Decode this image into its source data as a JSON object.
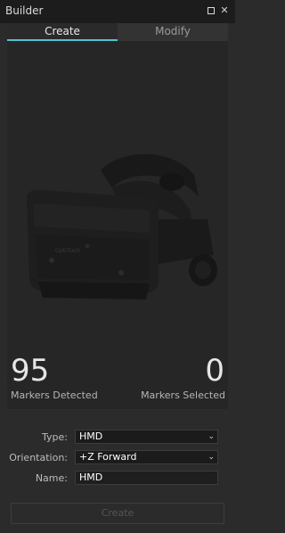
{
  "window": {
    "title": "Builder"
  },
  "tabs": [
    {
      "label": "Create",
      "active": true
    },
    {
      "label": "Modify",
      "active": false
    }
  ],
  "viewport": {
    "image": "hmd-headset",
    "brand_text": "OptiTrack"
  },
  "stats": {
    "detected": {
      "count": "95",
      "label": "Markers Detected"
    },
    "selected": {
      "count": "0",
      "label": "Markers Selected"
    }
  },
  "form": {
    "type": {
      "label": "Type:",
      "value": "HMD"
    },
    "orientation": {
      "label": "Orientation:",
      "value": "+Z Forward"
    },
    "name": {
      "label": "Name:",
      "value": "HMD"
    }
  },
  "actions": {
    "create_label": "Create"
  },
  "colors": {
    "accent": "#4ec3d8",
    "background": "#2b2b2b",
    "panel": "#262626"
  }
}
